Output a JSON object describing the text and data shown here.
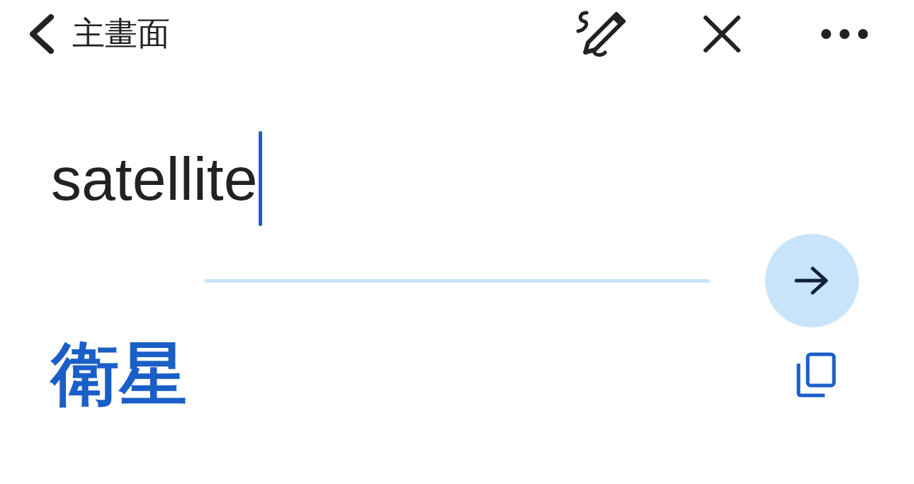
{
  "header": {
    "back_label": "主畫面"
  },
  "input": {
    "value": "satellite",
    "focused": true
  },
  "translation": {
    "text": "衛星"
  }
}
